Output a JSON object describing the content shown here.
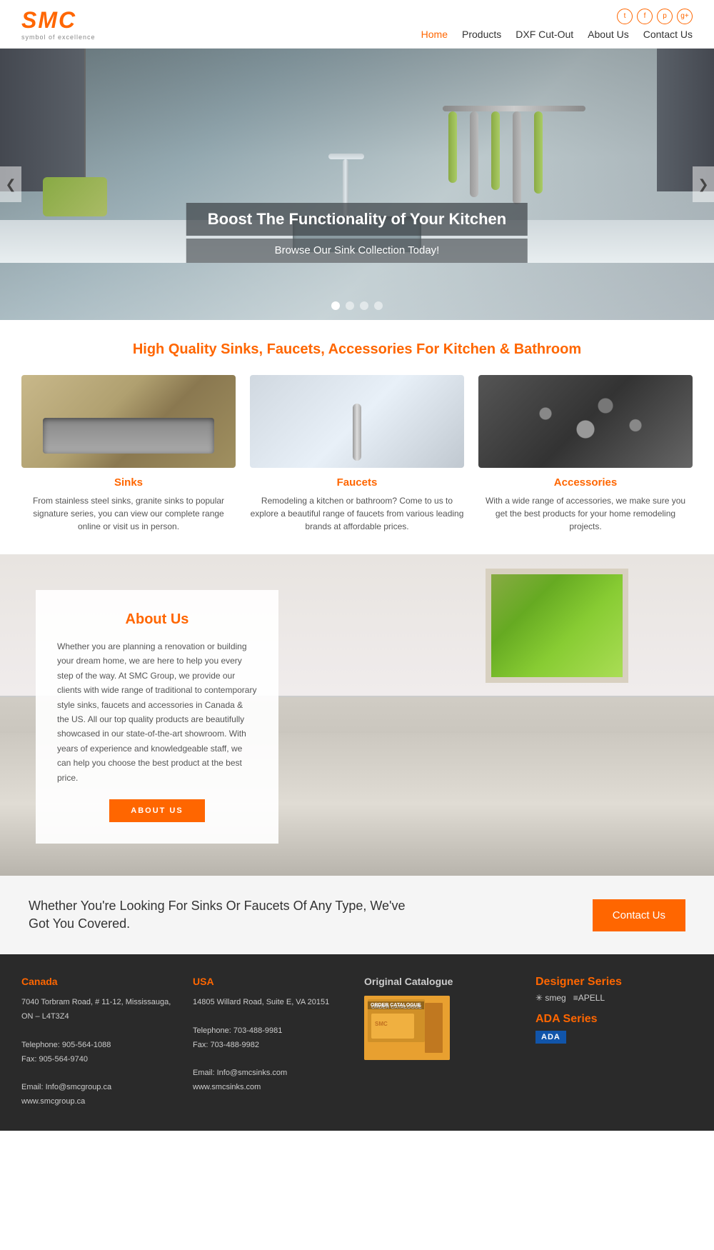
{
  "header": {
    "logo": "SMC",
    "logo_sub": "symbol of excellence",
    "nav": {
      "home": "Home",
      "products": "Products",
      "dxf": "DXF Cut-Out",
      "about": "About Us",
      "contact": "Contact Us"
    },
    "social": [
      "t",
      "f",
      "p",
      "g+"
    ]
  },
  "hero": {
    "title": "Boost The Functionality of Your Kitchen",
    "subtitle": "Browse Our Sink Collection Today!",
    "dots": [
      1,
      2,
      3,
      4
    ],
    "arrow_left": "❮",
    "arrow_right": "❯"
  },
  "products": {
    "section_title": "High Quality Sinks, Faucets, Accessories For Kitchen & Bathroom",
    "items": [
      {
        "name": "Sinks",
        "desc": "From stainless steel sinks, granite sinks to popular signature series, you can view our complete range online or visit us in person."
      },
      {
        "name": "Faucets",
        "desc": "Remodeling a kitchen or bathroom? Come to us to explore a beautiful range of faucets from various leading brands at affordable prices."
      },
      {
        "name": "Accessories",
        "desc": "With a wide range of accessories, we make sure you get the best products for your home remodeling projects."
      }
    ]
  },
  "about": {
    "title": "About Us",
    "text": "Whether you are planning a renovation or building your dream home, we are here to help you every step of the way. At SMC Group, we provide our clients with wide range of traditional to contemporary style sinks, faucets and accessories in Canada & the US. All our top quality products are beautifully showcased in our state-of-the-art showroom. With years of experience and knowledgeable staff, we can help you choose the best product at the best price.",
    "button": "ABOUT US"
  },
  "cta": {
    "text": "Whether You're Looking For Sinks Or Faucets Of Any Type, We've Got You Covered.",
    "button": "Contact Us"
  },
  "footer": {
    "canada": {
      "title": "Canada",
      "address": "7040 Torbram Road, # 11-12, Mississauga, ON – L4T3Z4",
      "phone": "Telephone: 905-564-1088",
      "fax": "Fax: 905-564-9740",
      "email": "Email: Info@smcgroup.ca",
      "website": "www.smcgroup.ca"
    },
    "usa": {
      "title": "USA",
      "address": "14805 Willard Road, Suite E, VA 20151",
      "phone": "Telephone: 703-488-9981",
      "fax": "Fax: 703-488-9982",
      "email": "Email: Info@smcsinks.com",
      "website": "www.smcsinks.com"
    },
    "catalogue": {
      "title": "Original Catalogue"
    },
    "brands": {
      "designer_series": "Designer Series",
      "designer_brands": "✳smeg  ≡APELL",
      "ada_series": "ADA Series",
      "ada_badge": "ADA"
    }
  }
}
